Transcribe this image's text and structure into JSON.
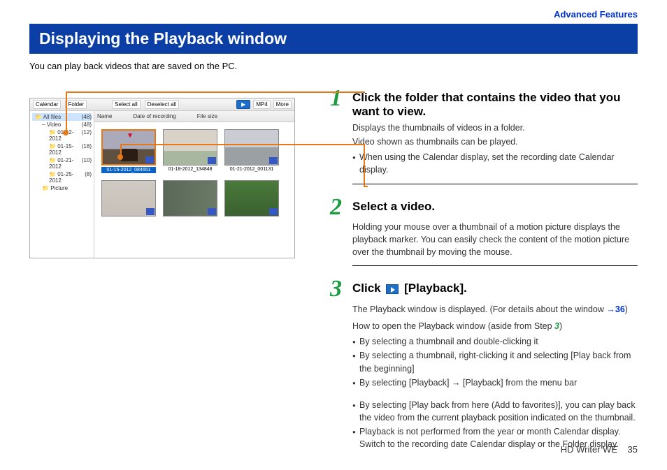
{
  "header": {
    "section_link": "Advanced Features"
  },
  "title": "Displaying the Playback window",
  "intro": "You can play back videos that are saved on the PC.",
  "screenshot": {
    "toolbar": {
      "calendar": "Calendar",
      "folder": "Folder",
      "select_all": "Select all",
      "deselect_all": "Deselect all",
      "mp4": "MP4",
      "more": "More"
    },
    "tree": {
      "all_files": "All files",
      "all_count": "(48)",
      "video": "Video",
      "video_count": "(48)",
      "d1": "01-12-2012",
      "d1c": "(12)",
      "d2": "01-15-2012",
      "d2c": "(18)",
      "d3": "01-21-2012",
      "d3c": "(10)",
      "d4": "01-25-2012",
      "d4c": "(8)",
      "picture": "Picture"
    },
    "cols": {
      "name": "Name",
      "date": "Date of recording",
      "size": "File size"
    },
    "thumbs": {
      "t1": "01-15-2012_084651",
      "t2": "01-18-2012_134848",
      "t3": "01-21-2012_001131"
    }
  },
  "steps": {
    "s1": {
      "num": "1",
      "title": "Click the folder that contains the video that you want to view.",
      "l1": "Displays the thumbnails of videos in a folder.",
      "l2": "Video shown as thumbnails can be played.",
      "b1": "When using the Calendar display, set the recording date Calendar display."
    },
    "s2": {
      "num": "2",
      "title": "Select a video.",
      "l1": "Holding your mouse over a thumbnail of a motion picture displays the playback marker. You can easily check the content of the motion picture over the thumbnail by moving the mouse."
    },
    "s3": {
      "num": "3",
      "title_pre": "Click",
      "title_post": "[Playback].",
      "l1a": "The Playback window is displayed. (For details about the window ",
      "link_arrow": "→",
      "link_num": "36",
      "l1b": ")",
      "l2a": "How to open the Playback window (aside from Step ",
      "l2num": "3",
      "l2b": ")",
      "b1": "By selecting a thumbnail and double-clicking it",
      "b2": "By selecting a thumbnail, right-clicking it and selecting [Play back from the beginning]",
      "b3": "By selecting [Playback] → [Playback] from the menu bar",
      "b4": "By selecting [Play back from here (Add to favorites)], you can play back the video from the current playback position indicated on the thumbnail.",
      "b5": "Playback is not performed from the year or month Calendar display. Switch to the recording date Calendar display or the Folder display."
    }
  },
  "footer": {
    "product": "HD Writer WE",
    "page": "35"
  }
}
